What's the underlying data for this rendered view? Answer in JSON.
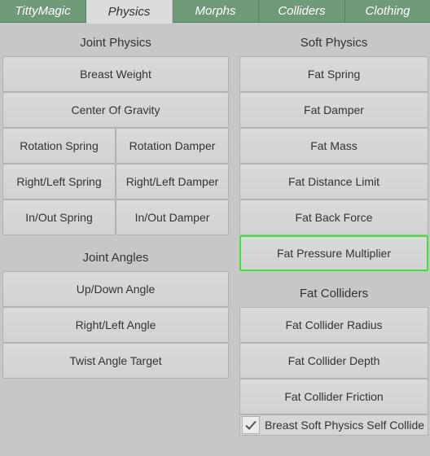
{
  "tabs": [
    {
      "label": "TittyMagic",
      "active": false
    },
    {
      "label": "Physics",
      "active": true
    },
    {
      "label": "Morphs",
      "active": false
    },
    {
      "label": "Colliders",
      "active": false
    },
    {
      "label": "Clothing",
      "active": false
    }
  ],
  "colors": {
    "tab_inactive": "#6f9a78",
    "tab_active": "#dcdcdc",
    "background": "#c7c7c7",
    "button": "#d6d6d6",
    "selected_outline": "#3fe13f"
  },
  "left": {
    "joint_physics": {
      "heading": "Joint Physics",
      "breast_weight": "Breast Weight",
      "center_of_gravity": "Center Of Gravity",
      "rotation_spring": "Rotation Spring",
      "rotation_damper": "Rotation Damper",
      "right_left_spring": "Right/Left Spring",
      "right_left_damper": "Right/Left Damper",
      "in_out_spring": "In/Out Spring",
      "in_out_damper": "In/Out Damper"
    },
    "joint_angles": {
      "heading": "Joint Angles",
      "up_down_angle": "Up/Down Angle",
      "right_left_angle": "Right/Left Angle",
      "twist_angle_target": "Twist Angle Target"
    }
  },
  "right": {
    "soft_physics": {
      "heading": "Soft Physics",
      "fat_spring": "Fat Spring",
      "fat_damper": "Fat Damper",
      "fat_mass": "Fat Mass",
      "fat_distance_limit": "Fat Distance Limit",
      "fat_back_force": "Fat Back Force",
      "fat_pressure_multiplier": "Fat Pressure Multiplier"
    },
    "fat_colliders": {
      "heading": "Fat Colliders",
      "fat_collider_radius": "Fat Collider Radius",
      "fat_collider_depth": "Fat Collider Depth",
      "fat_collider_friction": "Fat Collider Friction"
    },
    "self_collide": {
      "label": "Breast Soft Physics Self Collide",
      "checked": true,
      "icon": "check-icon"
    }
  }
}
